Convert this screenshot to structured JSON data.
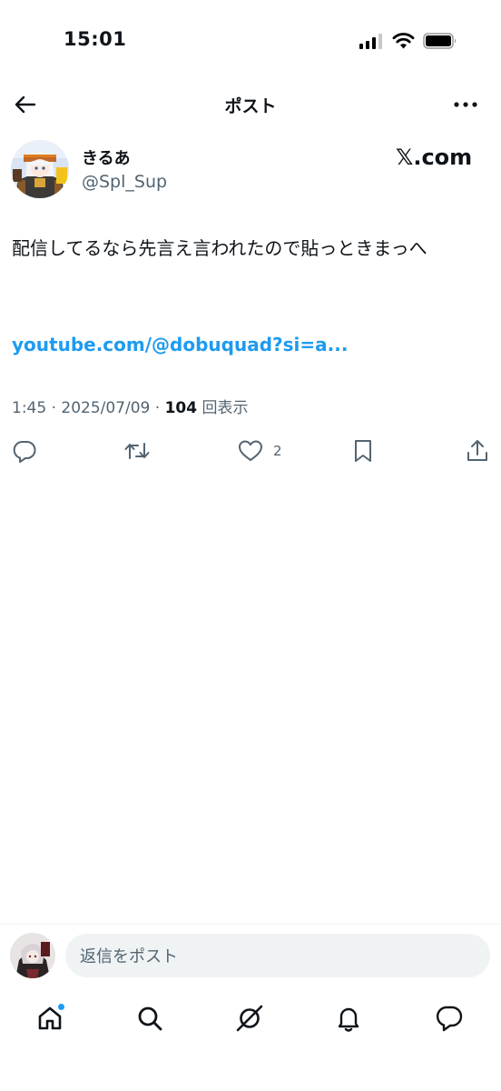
{
  "status_bar": {
    "time": "15:01"
  },
  "nav": {
    "title": "ポスト",
    "back_icon": "arrow-left-icon",
    "more_icon": "more-horizontal-icon"
  },
  "post": {
    "author": {
      "display_name": "きるあ",
      "handle": "@Spl_Sup",
      "avatar": "avatar-image"
    },
    "source_tag": "𝕏.com",
    "text": "配信してるなら先言え言われたので貼っときまっへ",
    "link": "youtube.com/@dobuquad?si=a...",
    "meta": {
      "time_date": "1:45 · 2025/07/09 · ",
      "views_count": "104",
      "views_label": " 回表示"
    },
    "actions": {
      "reply_icon": "reply-icon",
      "repost_icon": "repost-icon",
      "like_icon": "heart-icon",
      "like_count": "2",
      "bookmark_icon": "bookmark-icon",
      "share_icon": "share-icon"
    }
  },
  "reply_bar": {
    "placeholder": "返信をポスト"
  },
  "tabbar": {
    "items": [
      "home-icon",
      "search-icon",
      "grok-icon",
      "bell-icon",
      "messages-icon"
    ],
    "home_has_dot": true
  },
  "colors": {
    "link": "#1d9bf0",
    "secondary_text": "#536471",
    "primary_text": "#0f1419",
    "input_bg": "#eff3f4"
  }
}
